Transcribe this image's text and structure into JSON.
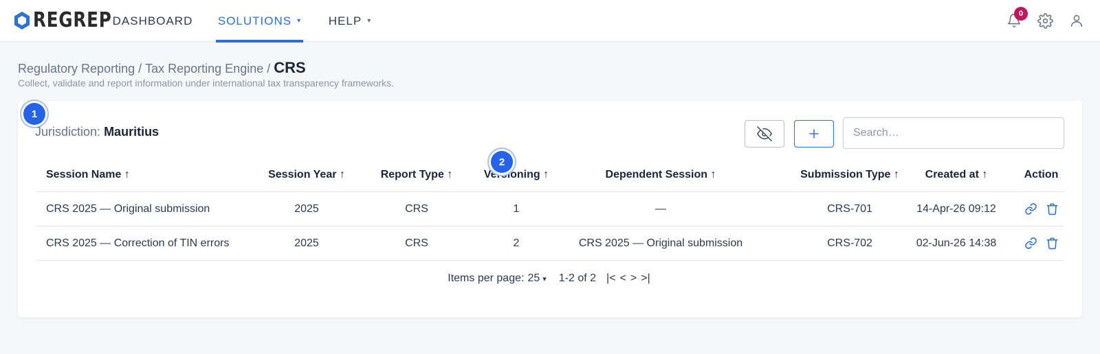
{
  "app": {
    "logo_text": "REGREP"
  },
  "nav": {
    "items": [
      {
        "label": "DASHBOARD",
        "has_caret": false,
        "active": false
      },
      {
        "label": "SOLUTIONS",
        "has_caret": true,
        "active": true
      },
      {
        "label": "HELP",
        "has_caret": true,
        "active": false
      }
    ],
    "caret": "▾"
  },
  "topbar_icons": {
    "notifications": "bell-icon",
    "notification_count": "0",
    "settings": "gear-icon",
    "user": "user-icon"
  },
  "breadcrumb": {
    "items": [
      "Regulatory Reporting",
      "Tax Reporting Engine"
    ],
    "separator": "/",
    "current": "CRS"
  },
  "subtitle": "Collect, validate and report information under international tax transparency frameworks.",
  "card": {
    "jurisdiction_label": "Jurisdiction:",
    "jurisdiction_value": "Mauritius",
    "hide_button_icon": "eye-off-icon",
    "add_button_icon": "plus-icon",
    "search_placeholder": "Search…",
    "step_badges": [
      "1",
      "2"
    ]
  },
  "table": {
    "columns": [
      "Session Name ↑",
      "Session Year ↑",
      "Report Type ↑",
      "Versioning ↑",
      "Dependent Session ↑",
      "Submission Type ↑",
      "Created at ↑",
      "Action"
    ],
    "rows": [
      {
        "name": "CRS 2025 — Original submission",
        "year": "2025",
        "report_type": "CRS",
        "version": "1",
        "dependent": "—",
        "submission_type": "CRS-701",
        "created": "14-Apr-26 09:12"
      },
      {
        "name": "CRS 2025 — Correction of TIN errors",
        "year": "2025",
        "report_type": "CRS",
        "version": "2",
        "dependent": "CRS 2025 — Original submission",
        "submission_type": "CRS-702",
        "created": "02-Jun-26 14:38"
      }
    ],
    "action_icons": [
      "link-icon",
      "trash-icon"
    ]
  },
  "pagination": {
    "items_per_page_label": "Items per page:",
    "items_per_page_value": "25",
    "caret": "▾",
    "range": "1-2 of 2",
    "first": "|<",
    "prev": "<",
    "next": ">",
    "last": ">|"
  },
  "colors": {
    "accent": "#2f6fd6",
    "badge_red": "#c2185b",
    "step_badge": "#2563eb"
  }
}
